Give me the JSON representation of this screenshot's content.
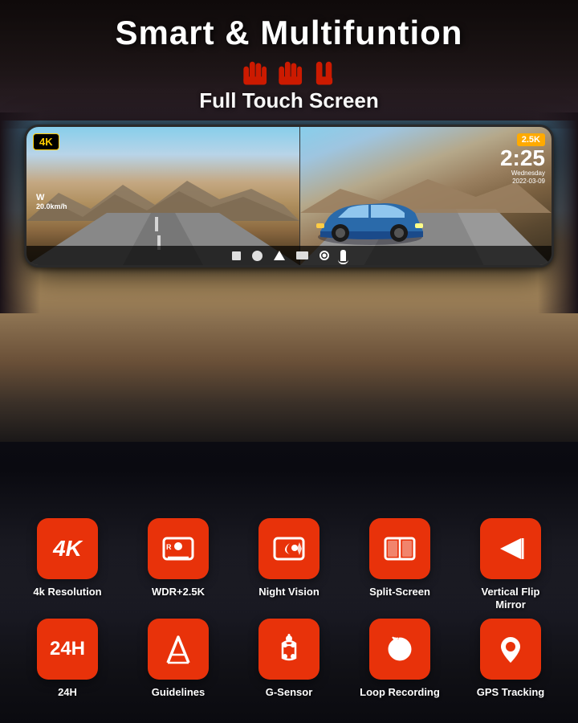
{
  "header": {
    "title": "Smart & Multifuntion",
    "subtitle": "Full Touch Screen"
  },
  "mirror": {
    "badge_4k": "4K",
    "badge_25k": "2.5K",
    "time": "2:25",
    "day": "Wednesday",
    "date": "2022-03-09",
    "speed": "20.0km/h",
    "direction": "W"
  },
  "features_row1": [
    {
      "id": "4k-resolution",
      "label": "4k Resolution",
      "icon": "4k"
    },
    {
      "id": "wdr-25k",
      "label": "WDR+2.5K",
      "icon": "wdr"
    },
    {
      "id": "night-vision",
      "label": "Night Vision",
      "icon": "night"
    },
    {
      "id": "split-screen",
      "label": "Split-Screen",
      "icon": "split"
    },
    {
      "id": "vertical-flip",
      "label": "Vertical Flip Mirror",
      "icon": "flip"
    }
  ],
  "features_row2": [
    {
      "id": "24h",
      "label": "24H",
      "icon": "24h"
    },
    {
      "id": "guidelines",
      "label": "Guidelines",
      "icon": "guide"
    },
    {
      "id": "g-sensor",
      "label": "G-Sensor",
      "icon": "gsensor"
    },
    {
      "id": "loop-recording",
      "label": "Loop Recording",
      "icon": "loop"
    },
    {
      "id": "gps-tracking",
      "label": "GPS Tracking",
      "icon": "gps"
    }
  ]
}
